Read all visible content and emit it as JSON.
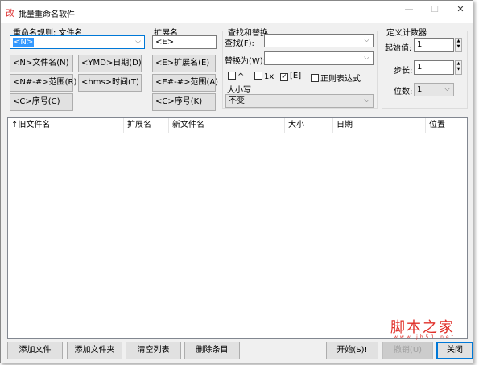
{
  "window": {
    "title": "批量重命名软件",
    "icon": "app-icon",
    "minimize": "—",
    "maximize": "☐",
    "close": "✕"
  },
  "rule": {
    "label": "重命名规则: 文件名",
    "value": "<N>",
    "buttons": [
      "<N>文件名(N)",
      "<YMD>日期(D)",
      "<N#-#>范围(R)",
      "<hms>时间(T)",
      "<C>序号(C)"
    ]
  },
  "ext": {
    "label": "扩展名",
    "value": "<E>",
    "buttons": [
      "<E>扩展名(E)",
      "<E#-#>范围(A)",
      "<C>序号(K)"
    ]
  },
  "find": {
    "group": "查找和替换",
    "find_label": "查找(F):",
    "find_value": "",
    "replace_label": "替换为(W):",
    "replace_value": "",
    "checkboxes": [
      {
        "label": "^",
        "checked": false
      },
      {
        "label": "1x",
        "checked": false
      },
      {
        "label": "[E]",
        "checked": true
      },
      {
        "label": "正则表达式",
        "checked": false
      }
    ],
    "case_label": "大小写",
    "case_value": "不变"
  },
  "counter": {
    "group": "定义计数器",
    "start_label": "起始值:",
    "start_value": "1",
    "step_label": "步长:",
    "step_value": "1",
    "digits_label": "位数:",
    "digits_value": "1"
  },
  "list": {
    "columns": [
      "↑旧文件名",
      "扩展名",
      "新文件名",
      "大小",
      "日期",
      "位置"
    ],
    "rows": []
  },
  "buttons": {
    "add_file": "添加文件",
    "add_folder": "添加文件夹",
    "clear": "清空列表",
    "delete": "删除条目",
    "start": "开始(S)!",
    "undo": "撤销(U)",
    "close": "关闭"
  },
  "watermark": {
    "text": "脚本之家",
    "url": "www.jb51.net"
  }
}
